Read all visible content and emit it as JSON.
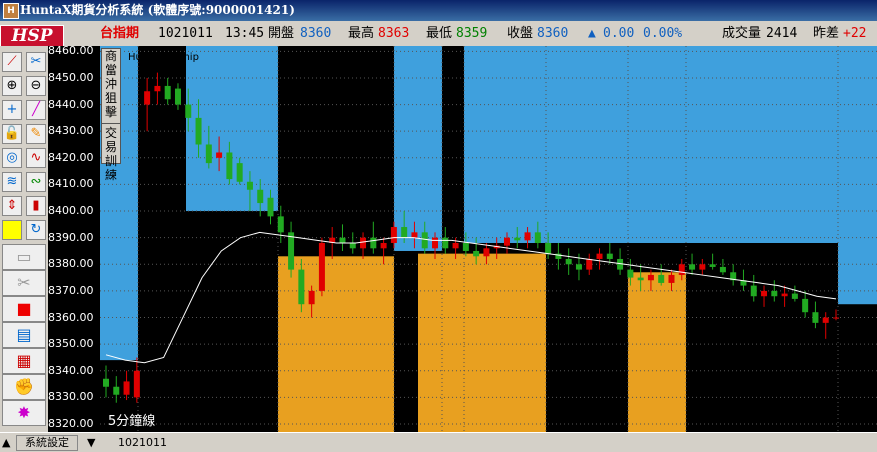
{
  "window": {
    "title": "HuntaX期貨分析系統 (軟體序號:9000001421)",
    "logo": "HSP"
  },
  "quote": {
    "symbol": "台指期",
    "date": "1021011",
    "time": "13:45",
    "open_label": "開盤",
    "open": "8360",
    "high_label": "最高",
    "high": "8363",
    "low_label": "最低",
    "low": "8359",
    "close_label": "收盤",
    "close": "8360",
    "change": "0.00",
    "change_pct": "0.00%",
    "volume_label": "成交量",
    "volume": "2414",
    "diff_label": "昨差",
    "diff": "+22"
  },
  "side_tabs": {
    "tab1": "商當沖狙擊",
    "tab2": "交易訓練"
  },
  "chart_label": "Huntax06.mip",
  "chart_caption": "5分鐘線",
  "status": {
    "settings": "系統設定",
    "date": "1021011"
  },
  "colors": {
    "bg": "#000000",
    "up": "#e00000",
    "down": "#22aa22",
    "blue_band": "#3fa0dd",
    "orange_band": "#e8a020",
    "ma": "#ffffff"
  },
  "chart_data": {
    "type": "candlestick",
    "y_ticks": [
      "8460.00",
      "8450.00",
      "8440.00",
      "8430.00",
      "8420.00",
      "8410.00",
      "8400.00",
      "8390.00",
      "8380.00",
      "8370.00",
      "8360.00",
      "8350.00",
      "8340.00",
      "8330.00",
      "8320.00"
    ],
    "ylim": [
      8317,
      8462
    ],
    "candles": [
      [
        8337,
        8342,
        8330,
        8334
      ],
      [
        8334,
        8338,
        8328,
        8331
      ],
      [
        8331,
        8340,
        8329,
        8336
      ],
      [
        8330,
        8345,
        8328,
        8340
      ],
      [
        8440,
        8450,
        8430,
        8445
      ],
      [
        8445,
        8452,
        8440,
        8447
      ],
      [
        8447,
        8450,
        8440,
        8442
      ],
      [
        8446,
        8448,
        8438,
        8440
      ],
      [
        8440,
        8446,
        8430,
        8435
      ],
      [
        8435,
        8442,
        8420,
        8425
      ],
      [
        8425,
        8432,
        8416,
        8418
      ],
      [
        8420,
        8428,
        8415,
        8422
      ],
      [
        8422,
        8426,
        8410,
        8412
      ],
      [
        8418,
        8420,
        8410,
        8411
      ],
      [
        8411,
        8415,
        8400,
        8408
      ],
      [
        8408,
        8412,
        8398,
        8403
      ],
      [
        8405,
        8408,
        8395,
        8398
      ],
      [
        8398,
        8402,
        8388,
        8392
      ],
      [
        8392,
        8396,
        8375,
        8378
      ],
      [
        8378,
        8382,
        8362,
        8365
      ],
      [
        8365,
        8372,
        8360,
        8370
      ],
      [
        8370,
        8390,
        8368,
        8388
      ],
      [
        8388,
        8394,
        8382,
        8390
      ],
      [
        8390,
        8395,
        8385,
        8388
      ],
      [
        8388,
        8392,
        8384,
        8386
      ],
      [
        8386,
        8392,
        8382,
        8390
      ],
      [
        8390,
        8396,
        8384,
        8386
      ],
      [
        8386,
        8390,
        8380,
        8388
      ],
      [
        8388,
        8396,
        8386,
        8394
      ],
      [
        8394,
        8400,
        8388,
        8390
      ],
      [
        8390,
        8396,
        8386,
        8392
      ],
      [
        8392,
        8396,
        8384,
        8386
      ],
      [
        8386,
        8392,
        8382,
        8390
      ],
      [
        8390,
        8394,
        8384,
        8386
      ],
      [
        8386,
        8390,
        8382,
        8388
      ],
      [
        8388,
        8392,
        8383,
        8385
      ],
      [
        8385,
        8390,
        8380,
        8383
      ],
      [
        8383,
        8388,
        8380,
        8386
      ],
      [
        8386,
        8390,
        8382,
        8387
      ],
      [
        8387,
        8392,
        8384,
        8390
      ],
      [
        8390,
        8394,
        8386,
        8389
      ],
      [
        8389,
        8394,
        8386,
        8392
      ],
      [
        8392,
        8396,
        8386,
        8388
      ],
      [
        8388,
        8392,
        8382,
        8384
      ],
      [
        8384,
        8388,
        8378,
        8382
      ],
      [
        8382,
        8386,
        8376,
        8380
      ],
      [
        8380,
        8384,
        8374,
        8378
      ],
      [
        8378,
        8384,
        8376,
        8382
      ],
      [
        8382,
        8386,
        8378,
        8384
      ],
      [
        8384,
        8388,
        8380,
        8382
      ],
      [
        8382,
        8386,
        8376,
        8378
      ],
      [
        8378,
        8382,
        8372,
        8375
      ],
      [
        8375,
        8380,
        8370,
        8374
      ],
      [
        8374,
        8378,
        8370,
        8376
      ],
      [
        8376,
        8380,
        8372,
        8373
      ],
      [
        8373,
        8378,
        8370,
        8376
      ],
      [
        8376,
        8382,
        8374,
        8380
      ],
      [
        8380,
        8384,
        8376,
        8378
      ],
      [
        8378,
        8382,
        8376,
        8380
      ],
      [
        8380,
        8384,
        8378,
        8379
      ],
      [
        8379,
        8382,
        8376,
        8377
      ],
      [
        8377,
        8380,
        8372,
        8374
      ],
      [
        8374,
        8378,
        8370,
        8372
      ],
      [
        8372,
        8376,
        8366,
        8368
      ],
      [
        8368,
        8372,
        8364,
        8370
      ],
      [
        8370,
        8374,
        8366,
        8368
      ],
      [
        8368,
        8372,
        8364,
        8369
      ],
      [
        8369,
        8372,
        8366,
        8367
      ],
      [
        8367,
        8370,
        8360,
        8362
      ],
      [
        8362,
        8366,
        8356,
        8358
      ],
      [
        8358,
        8362,
        8352,
        8360
      ],
      [
        8360,
        8363,
        8359,
        8360
      ]
    ],
    "ma": [
      8346,
      8344,
      8343,
      8345,
      8360,
      8375,
      8385,
      8390,
      8392,
      8391,
      8390,
      8389,
      8388,
      8388,
      8389,
      8390,
      8390,
      8389,
      8389,
      8388,
      8387,
      8386,
      8385,
      8384,
      8383,
      8382,
      8381,
      8380,
      8379,
      8378,
      8377,
      8376,
      8375,
      8374,
      8373,
      8372,
      8370,
      8368,
      8367
    ]
  }
}
